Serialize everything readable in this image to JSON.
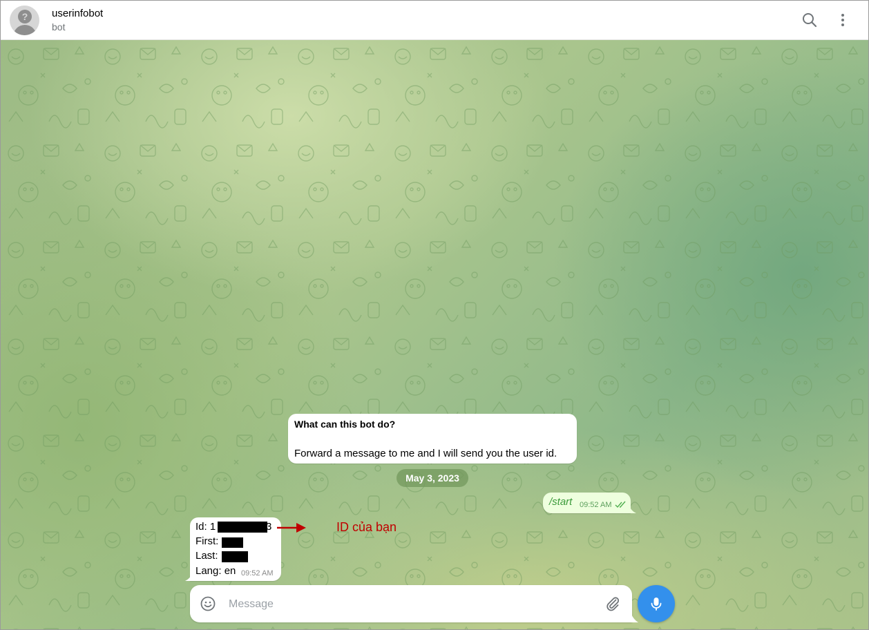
{
  "header": {
    "title": "userinfobot",
    "subtitle": "bot",
    "avatar_icon": "default-avatar-icon",
    "search_icon": "search-icon",
    "menu_icon": "more-vertical-icon"
  },
  "intro": {
    "heading": "What can this bot do?",
    "body": "Forward a message to me and I will send you the user id."
  },
  "date_separator": "May 3, 2023",
  "outgoing": {
    "text": "/start",
    "time": "09:52 AM",
    "status_icon": "double-check-icon"
  },
  "incoming": {
    "id_label": "Id: 1",
    "id_tail": "3",
    "first_label": "First:",
    "last_label": "Last:",
    "lang_label": "Lang: en",
    "time": "09:52 AM"
  },
  "annotation": {
    "text": "ID của bạn",
    "color": "#c00000"
  },
  "composer": {
    "placeholder": "Message",
    "emoji_icon": "smile-icon",
    "attach_icon": "paperclip-icon",
    "mic_icon": "microphone-icon"
  },
  "colors": {
    "accent": "#3390ec",
    "outgoing_bubble": "#eeffde",
    "chat_background": "#9dbb85"
  }
}
